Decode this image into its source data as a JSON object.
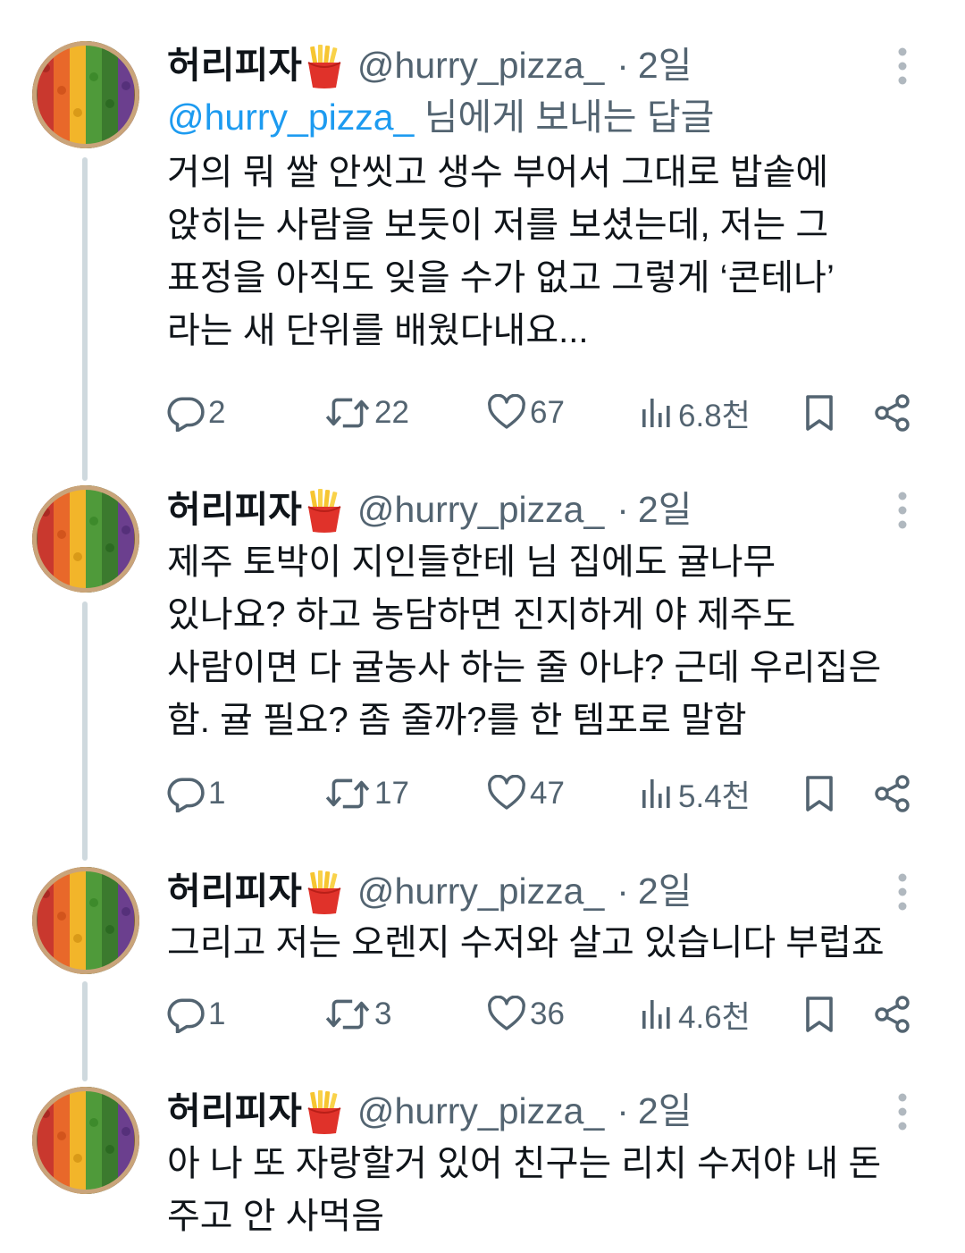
{
  "colors": {
    "text": "#0f1419",
    "secondary": "#536471",
    "link": "#1d9bf0",
    "thread_line": "#cfd9de"
  },
  "icons": {
    "avatar": "rainbow-vegetable-pizza-avatar",
    "name_emoji": "french-fries-icon",
    "more": "vertical-ellipsis-icon",
    "reply": "reply-bubble-icon",
    "retweet": "retweet-icon",
    "like": "heart-icon",
    "views": "bar-chart-icon",
    "bookmark": "bookmark-icon",
    "share": "share-icon"
  },
  "tweets": [
    {
      "display_name": "허리피자",
      "handle": "@hurry_pizza_",
      "separator": "·",
      "time": "2일",
      "reply_to": {
        "mention": "@hurry_pizza_",
        "suffix": " 님에게 보내는 답글"
      },
      "text": "거의 뭐 쌀 안씻고 생수 부어서 그대로 밥솥에\n앉히는 사람을 보듯이 저를 보셨는데, 저는 그\n표정을 아직도 잊을 수가 없고 그렇게 ‘콘테나’\n라는 새 단위를 배웠다내요...",
      "stats": {
        "replies": "2",
        "retweets": "22",
        "likes": "67",
        "views": "6.8천"
      }
    },
    {
      "display_name": "허리피자",
      "handle": "@hurry_pizza_",
      "separator": "·",
      "time": "2일",
      "text": "제주 토박이 지인들한테 님 집에도 귤나무\n있나요? 하고 농담하면 진지하게 야 제주도\n사람이면 다 귤농사 하는 줄 아냐? 근데 우리집은\n함. 귤 필요? 좀 줄까?를 한 템포로 말함",
      "stats": {
        "replies": "1",
        "retweets": "17",
        "likes": "47",
        "views": "5.4천"
      }
    },
    {
      "display_name": "허리피자",
      "handle": "@hurry_pizza_",
      "separator": "·",
      "time": "2일",
      "text": "그리고 저는 오렌지 수저와 살고 있습니다 부럽죠",
      "stats": {
        "replies": "1",
        "retweets": "3",
        "likes": "36",
        "views": "4.6천"
      }
    },
    {
      "display_name": "허리피자",
      "handle": "@hurry_pizza_",
      "separator": "·",
      "time": "2일",
      "text": "아 나 또 자랑할거 있어 친구는 리치 수저야 내 돈\n주고 안 사먹음"
    }
  ]
}
